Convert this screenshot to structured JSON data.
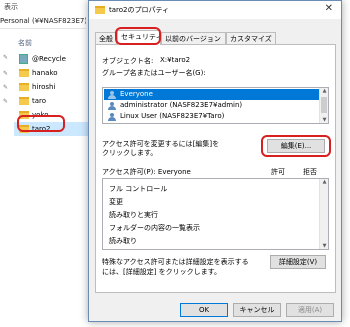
{
  "explorer": {
    "menu": "表示",
    "address": "Personal (¥¥NASF823E7) ›",
    "column_header": "名前",
    "items": [
      {
        "label": "@Recycle",
        "icon": "recycle-folder-icon"
      },
      {
        "label": "hanako",
        "icon": "folder-icon"
      },
      {
        "label": "hiroshi",
        "icon": "folder-icon"
      },
      {
        "label": "taro",
        "icon": "folder-icon"
      },
      {
        "label": "yoko",
        "icon": "folder-icon"
      },
      {
        "label": "taro2",
        "icon": "folder-icon"
      }
    ],
    "selected_item": "taro2"
  },
  "dialog": {
    "title": "taro2のプロパティ",
    "close_glyph": "✕",
    "tabs": [
      "全般",
      "セキュリティ",
      "以前のバージョン",
      "カスタマイズ"
    ],
    "active_tab": "セキュリティ",
    "object_name_label": "オブジェクト名:",
    "object_name_value": "X:¥taro2",
    "group_label": "グループ名またはユーザー名(G):",
    "users": [
      "Everyone",
      "administrator (NASF823E7¥admin)",
      "Linux User (NASF823E7¥Taro)"
    ],
    "selected_user": "Everyone",
    "change_perm_text": "アクセス許可を変更するには[編集]を\nクリックします。",
    "edit_button": "編集(E)...",
    "perm_header": "アクセス許可(P): Everyone",
    "perm_allow": "許可",
    "perm_deny": "拒否",
    "permissions": [
      "フル コントロール",
      "変更",
      "読み取りと実行",
      "フォルダーの内容の一覧表示",
      "読み取り"
    ],
    "advanced_text": "特殊なアクセス許可または詳細設定を表示するには、[詳細設定] をクリックします。",
    "advanced_text_line1": "特殊なアクセス許可または詳細設定を表示する",
    "advanced_text_line2": "には、[詳細設定] をクリックします。",
    "advanced_button": "詳細設定(V)",
    "ok_button": "OK",
    "cancel_button": "キャンセル",
    "apply_button": "適用(A)"
  },
  "colors": {
    "selection": "#0078d7",
    "highlight_box": "#d82020",
    "folder": "#f5c94b"
  }
}
